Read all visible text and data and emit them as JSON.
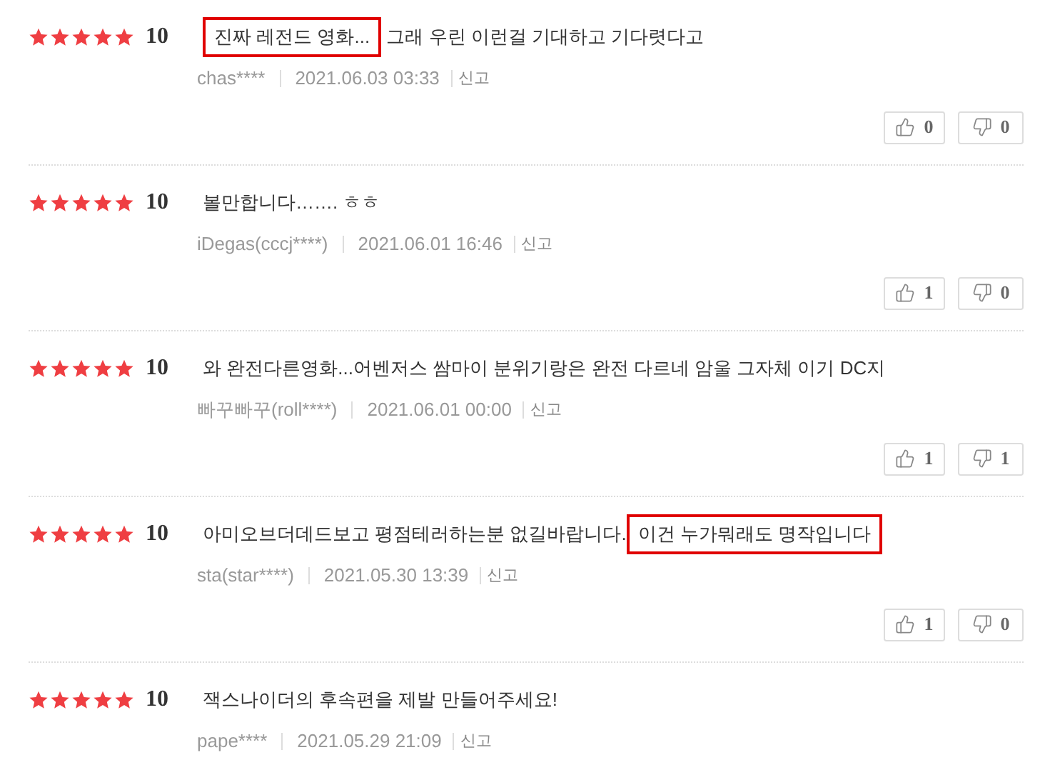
{
  "reviews": [
    {
      "stars": 5,
      "score": "10",
      "comment": [
        {
          "text": "진짜 레전드 영화...",
          "highlight": true
        },
        {
          "text": " 그래 우린 이런걸 기대하고 기다렷다고",
          "highlight": false
        }
      ],
      "user": "chas****",
      "date": "2021.06.03 03:33",
      "report": "신고",
      "likes": "0",
      "dislikes": "0"
    },
    {
      "stars": 5,
      "score": "10",
      "comment": [
        {
          "text": "볼만합니다……. ㅎㅎ",
          "highlight": false
        }
      ],
      "user": "iDegas(cccj****)",
      "date": "2021.06.01 16:46",
      "report": "신고",
      "likes": "1",
      "dislikes": "0"
    },
    {
      "stars": 5,
      "score": "10",
      "comment": [
        {
          "text": "와 완전다른영화...어벤저스 쌈마이 분위기랑은 완전 다르네 암울 그자체 이기 DC지",
          "highlight": false
        }
      ],
      "user": "빠꾸빠꾸(roll****)",
      "date": "2021.06.01 00:00",
      "report": "신고",
      "likes": "1",
      "dislikes": "1"
    },
    {
      "stars": 5,
      "score": "10",
      "comment": [
        {
          "text": "아미오브더데드보고 평점테러하는분 없길바랍니다.",
          "highlight": false
        },
        {
          "text": "이건 누가뭐래도 명작입니다",
          "highlight": true
        }
      ],
      "user": "sta(star****)",
      "date": "2021.05.30 13:39",
      "report": "신고",
      "likes": "1",
      "dislikes": "0"
    },
    {
      "stars": 5,
      "score": "10",
      "comment": [
        {
          "text": "잭스나이더의 후속편을 제발 만들어주세요!",
          "highlight": false
        }
      ],
      "user": "pape****",
      "date": "2021.05.29 21:09",
      "report": "신고"
    }
  ]
}
